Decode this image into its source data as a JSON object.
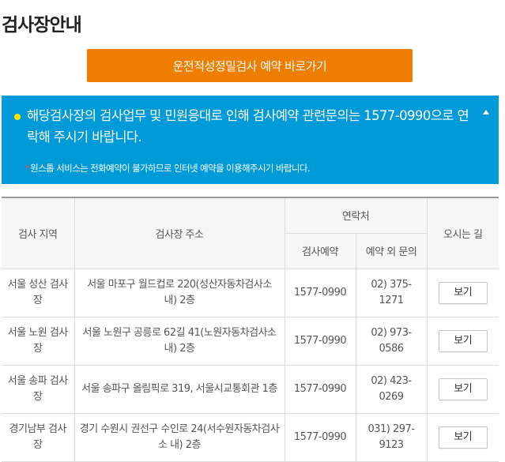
{
  "page": {
    "title": "검사장안내"
  },
  "reserve_button": {
    "label": "운전적성정밀검사 예약 바로가기"
  },
  "notice": {
    "main": "해당검사장의 검사업무 및 민원응대로 인해 검사예약 관련문의는 1577-0990으로 연락해 주시기 바랍니다.",
    "sub_marker": "*",
    "sub": "원스톱 서비스는 전화예약이 불가하므로 인터넷 예약을 이용해주시기 바랍니다.",
    "colors": {
      "background": "#009ad8",
      "bullet": "#ffe200"
    }
  },
  "table": {
    "headers": {
      "region": "검사 지역",
      "address": "검사장 주소",
      "contact": "연락처",
      "contact_reserve": "검사예약",
      "contact_other": "예약 외 문의",
      "directions": "오시는 길"
    },
    "rows": [
      {
        "region": "서울 성산 검사장",
        "address": "서울 마포구 월드컵로 220(성산자동차검사소 내) 2층",
        "reserve": "1577-0990",
        "other": "02) 375-1271",
        "button": "보기"
      },
      {
        "region": "서울 노원 검사장",
        "address": "서울 노원구 공릉로 62길 41(노원자동차검사소 내) 2층",
        "reserve": "1577-0990",
        "other": "02) 973-0586",
        "button": "보기"
      },
      {
        "region": "서울 송파 검사장",
        "address": "서울 송파구 올림픽로 319, 서울시교통회관 1층",
        "reserve": "1577-0990",
        "other": "02) 423-0269",
        "button": "보기"
      },
      {
        "region": "경기남부 검사장",
        "address": "경기 수원시 권선구 수인로 24(서수원자동차검사소 내) 2층",
        "reserve": "1577-0990",
        "other": "031) 297-9123",
        "button": "보기"
      }
    ]
  },
  "colors": {
    "accent": "#ef7d00"
  }
}
